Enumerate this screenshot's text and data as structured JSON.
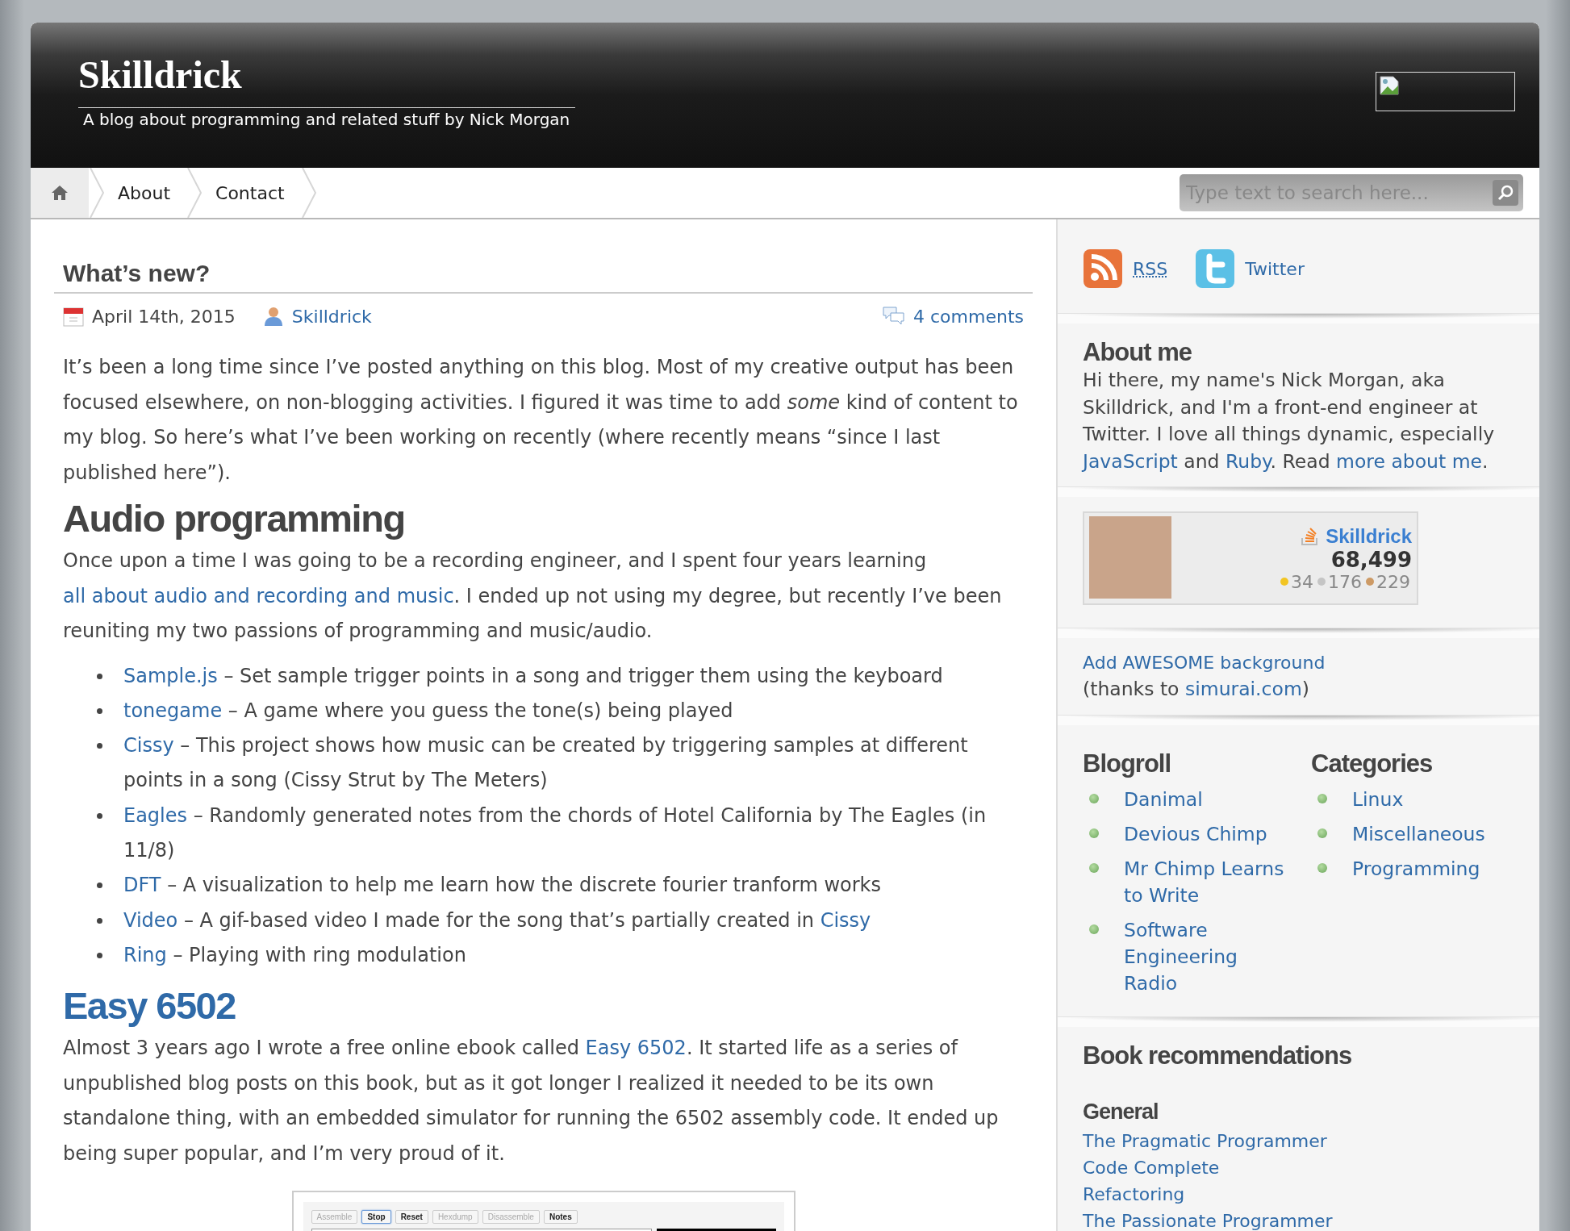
{
  "header": {
    "title": "Skilldrick",
    "tagline": "A blog about programming and related stuff by Nick Morgan"
  },
  "nav": {
    "items": [
      {
        "kind": "home"
      },
      {
        "kind": "page",
        "label": "About"
      },
      {
        "kind": "page",
        "label": "Contact"
      }
    ],
    "search": {
      "placeholder": "Type text to search here..."
    }
  },
  "post": {
    "title": "What’s new?",
    "date": "April 14th, 2015",
    "author": "Skilldrick",
    "comments": "4 comments",
    "blocks": [
      {
        "kind": "paragraph",
        "segments": [
          "It’s been a long time since I’ve posted anything on this blog. Most of my creative output has been focused elsewhere, on non-blogging activities. I figured it was time to add *some* kind of content to my blog. So here’s what I’ve been working on recently (where recently means “since I last published here”)."
        ]
      },
      {
        "kind": "heading",
        "text": "Audio programming",
        "link": false
      },
      {
        "kind": "paragraph",
        "segments": [
          "Once upon a time I was going to be a recording engineer, and I spent four years learning ",
          {
            "link": "all about audio and recording and music"
          },
          ". I ended up not using my degree, but recently I’ve been reuniting my two passions of programming and music/audio."
        ]
      },
      {
        "kind": "list",
        "items": [
          {
            "segments": [
              {
                "link": "Sample.js"
              },
              " – Set sample trigger points in a song and trigger them using the keyboard"
            ]
          },
          {
            "segments": [
              {
                "link": "tonegame"
              },
              " – A game where you guess the tone(s) being played"
            ]
          },
          {
            "segments": [
              {
                "link": "Cissy"
              },
              " – This project shows how music can be created by triggering samples at different points in a song (Cissy Strut by The Meters)"
            ]
          },
          {
            "segments": [
              {
                "link": "Eagles"
              },
              " – Randomly generated notes from the chords of Hotel California by The Eagles (in 11/8)"
            ]
          },
          {
            "segments": [
              {
                "link": "DFT"
              },
              " – A visualization to help me learn how the discrete fourier tranform works"
            ]
          },
          {
            "segments": [
              {
                "link": "Video"
              },
              " – A gif-based video I made for the song that’s partially created in ",
              {
                "link": "Cissy"
              }
            ]
          },
          {
            "segments": [
              {
                "link": "Ring"
              },
              " – Playing with ring modulation"
            ]
          }
        ]
      },
      {
        "kind": "heading",
        "text": "Easy 6502",
        "link": true
      },
      {
        "kind": "paragraph",
        "segments": [
          "Almost 3 years ago I wrote a free online ebook called ",
          {
            "link": "Easy 6502"
          },
          ". It started life as a series of unpublished blog posts on this book, but as it got longer I realized it needed to be its own standalone thing, with an embedded simulator for running the 6502 assembly code. It ended up being super popular, and I’m very proud of it."
        ]
      },
      {
        "kind": "screenshot",
        "buttons": [
          {
            "label": "Assemble",
            "disabled": true,
            "focused": false
          },
          {
            "label": "Stop",
            "disabled": false,
            "focused": true
          },
          {
            "label": "Reset",
            "disabled": false,
            "focused": false
          },
          {
            "label": "Hexdump",
            "disabled": true,
            "focused": false
          },
          {
            "label": "Disassemble",
            "disabled": true,
            "focused": false
          },
          {
            "label": "Notes",
            "disabled": false,
            "focused": false
          }
        ]
      }
    ]
  },
  "sidebar": {
    "social": [
      {
        "kind": "rss",
        "label": "RSS"
      },
      {
        "kind": "twitter",
        "label": "Twitter"
      }
    ],
    "about": {
      "title": "About me",
      "segments": [
        "Hi there, my name's Nick Morgan, aka Skilldrick, and I'm a front-end engineer at Twitter. I love all things dynamic, especially ",
        {
          "link": "JavaScript"
        },
        " and ",
        {
          "link": "Ruby"
        },
        ". Read ",
        {
          "link": "more about me"
        },
        "."
      ]
    },
    "flair": {
      "name": "Skilldrick",
      "reputation": "68,499",
      "badges": [
        {
          "count": "34",
          "color": "#f2c523"
        },
        {
          "count": "176",
          "color": "#c5c5c5"
        },
        {
          "count": "229",
          "color": "#cd9a65"
        }
      ]
    },
    "background": {
      "link": "Add AWESOME background",
      "segments": [
        "(thanks to ",
        {
          "link": "simurai.com"
        },
        ")"
      ]
    },
    "blogroll": {
      "title": "Blogroll",
      "items": [
        "Danimal",
        "Devious Chimp",
        "Mr Chimp Learns to Write",
        "Software Engineering Radio"
      ]
    },
    "categories": {
      "title": "Categories",
      "items": [
        "Linux",
        "Miscellaneous",
        "Programming"
      ]
    },
    "books": {
      "title": "Book recommendations",
      "groups": [
        {
          "title": "General",
          "items": [
            "The Pragmatic Programmer",
            "Code Complete",
            "Refactoring",
            "The Passionate Programmer"
          ]
        }
      ]
    }
  }
}
